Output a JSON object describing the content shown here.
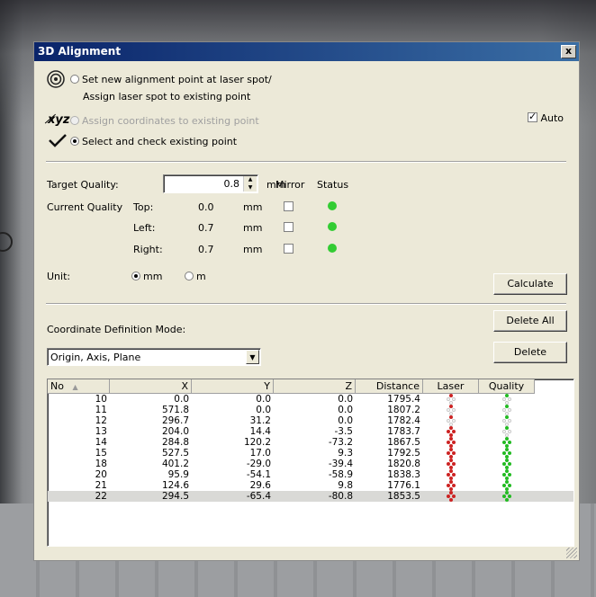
{
  "window": {
    "title": "3D Alignment",
    "close_label": "x"
  },
  "modes": {
    "set_new_line1": "Set new alignment point at laser spot/",
    "set_new_line2": "Assign laser spot to existing point",
    "assign_coords": "Assign coordinates to existing point",
    "select_check": "Select and check existing point",
    "selected": "select_check"
  },
  "auto": {
    "label": "Auto",
    "checked": true
  },
  "quality": {
    "target_label": "Target Quality:",
    "target_value": "0.8",
    "unit_header": "mm",
    "mirror_header": "Mirror",
    "status_header": "Status",
    "current_label": "Current Quality",
    "rows": [
      {
        "label": "Top:",
        "value": "0.0",
        "unit": "mm",
        "mirror": false,
        "status_color": "#33cc33"
      },
      {
        "label": "Left:",
        "value": "0.7",
        "unit": "mm",
        "mirror": false,
        "status_color": "#33cc33"
      },
      {
        "label": "Right:",
        "value": "0.7",
        "unit": "mm",
        "mirror": false,
        "status_color": "#33cc33"
      }
    ]
  },
  "unit": {
    "label": "Unit:",
    "options": [
      "mm",
      "m"
    ],
    "selected": "mm"
  },
  "buttons": {
    "calculate": "Calculate",
    "delete_all": "Delete All",
    "delete": "Delete"
  },
  "coord_mode": {
    "label": "Coordinate Definition Mode:",
    "value": "Origin, Axis, Plane"
  },
  "table": {
    "columns": [
      "No",
      "X",
      "Y",
      "Z",
      "Distance",
      "Laser",
      "Quality"
    ],
    "sort_indicator": "▲",
    "rows": [
      {
        "no": "10",
        "x": "0.0",
        "y": "0.0",
        "z": "0.0",
        "distance": "1795.4",
        "laser": "partial",
        "quality": "partial"
      },
      {
        "no": "11",
        "x": "571.8",
        "y": "0.0",
        "z": "0.0",
        "distance": "1807.2",
        "laser": "partial",
        "quality": "partial"
      },
      {
        "no": "12",
        "x": "296.7",
        "y": "31.2",
        "z": "0.0",
        "distance": "1782.4",
        "laser": "partial",
        "quality": "partial"
      },
      {
        "no": "13",
        "x": "204.0",
        "y": "14.4",
        "z": "-3.5",
        "distance": "1783.7",
        "laser": "full",
        "quality": "partial"
      },
      {
        "no": "14",
        "x": "284.8",
        "y": "120.2",
        "z": "-73.2",
        "distance": "1867.5",
        "laser": "full",
        "quality": "full"
      },
      {
        "no": "15",
        "x": "527.5",
        "y": "17.0",
        "z": "9.3",
        "distance": "1792.5",
        "laser": "full",
        "quality": "full"
      },
      {
        "no": "18",
        "x": "401.2",
        "y": "-29.0",
        "z": "-39.4",
        "distance": "1820.8",
        "laser": "full",
        "quality": "full"
      },
      {
        "no": "20",
        "x": "95.9",
        "y": "-54.1",
        "z": "-58.9",
        "distance": "1838.3",
        "laser": "full",
        "quality": "full"
      },
      {
        "no": "21",
        "x": "124.6",
        "y": "29.6",
        "z": "9.8",
        "distance": "1776.1",
        "laser": "full",
        "quality": "full"
      },
      {
        "no": "22",
        "x": "294.5",
        "y": "-65.4",
        "z": "-80.8",
        "distance": "1853.5",
        "laser": "full",
        "quality": "full"
      }
    ],
    "selected_no": "22"
  },
  "colors": {
    "laser": "#cc2222",
    "quality": "#22bb22",
    "title_bar": "#0a246a"
  }
}
